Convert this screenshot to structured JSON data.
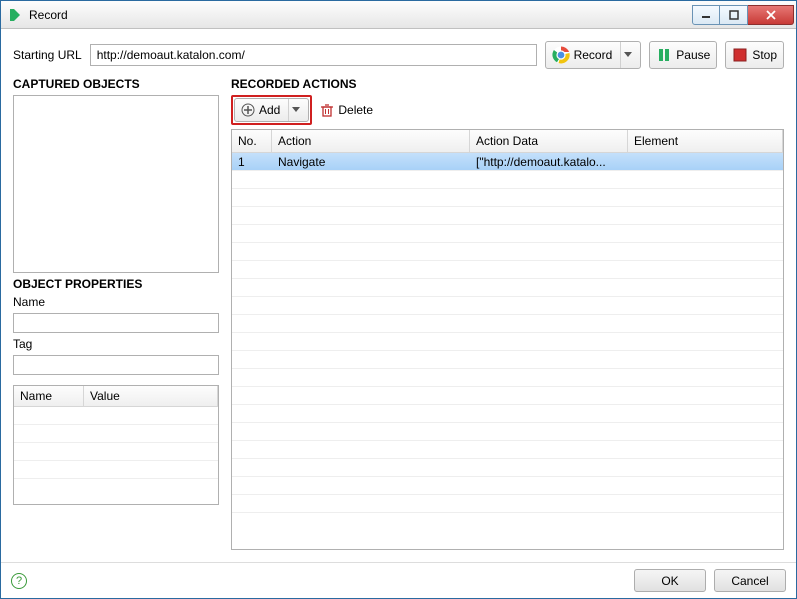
{
  "title": "Record",
  "url_row": {
    "label": "Starting URL",
    "value": "http://demoaut.katalon.com/"
  },
  "toolbar": {
    "record": "Record",
    "pause": "Pause",
    "stop": "Stop"
  },
  "left": {
    "captured_title": "CAPTURED OBJECTS",
    "props_title": "OBJECT PROPERTIES",
    "name_label": "Name",
    "name_value": "",
    "tag_label": "Tag",
    "tag_value": "",
    "prop_headers": {
      "name": "Name",
      "value": "Value"
    }
  },
  "right": {
    "rec_title": "RECORDED ACTIONS",
    "add": "Add",
    "delete": "Delete",
    "headers": {
      "no": "No.",
      "action": "Action",
      "data": "Action Data",
      "elem": "Element"
    },
    "rows": [
      {
        "no": "1",
        "action": "Navigate",
        "data": "[\"http://demoaut.katalo...",
        "elem": ""
      }
    ]
  },
  "footer": {
    "ok": "OK",
    "cancel": "Cancel"
  }
}
